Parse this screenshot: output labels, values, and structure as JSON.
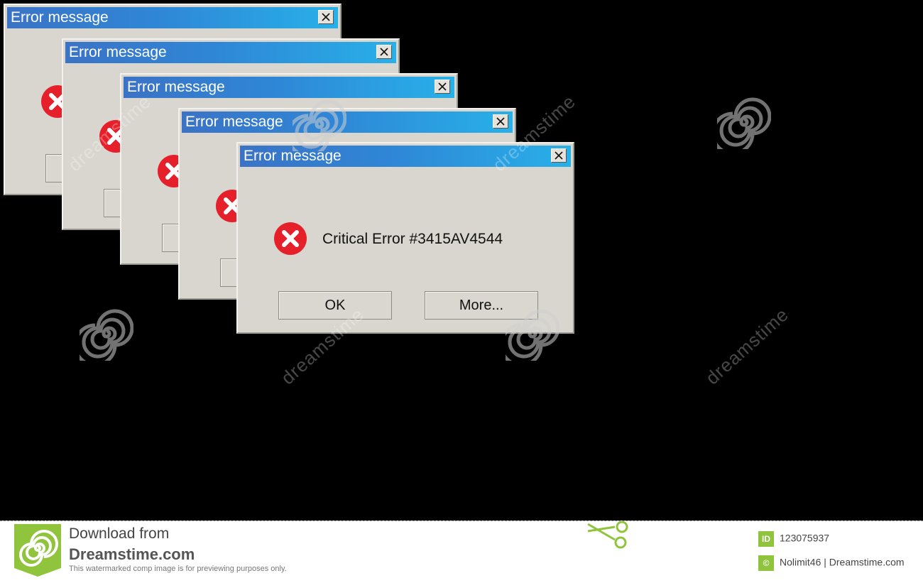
{
  "dialogs": [
    {
      "title": "Error message"
    },
    {
      "title": "Error message"
    },
    {
      "title": "Error message"
    },
    {
      "title": "Error message"
    },
    {
      "title": "Error message"
    }
  ],
  "front_dialog": {
    "title": "Error message",
    "message": "Critical Error #3415AV4544",
    "ok_label": "OK",
    "more_label": "More..."
  },
  "watermark": {
    "text": "dreamstime"
  },
  "footer": {
    "line1": "Download from",
    "line2": "Dreamstime.com",
    "line3": "This watermarked comp image is for previewing purposes only.",
    "id_badge": "ID",
    "image_id": "123075937",
    "credit": "Nolimit46 | Dreamstime.com"
  },
  "colors": {
    "background": "#000000",
    "dialog_bg": "#d9d6cf",
    "titlebar_start": "#3b73c6",
    "titlebar_end": "#28b0e8",
    "error_red": "#e5202a",
    "brand_green": "#8fc43c"
  }
}
